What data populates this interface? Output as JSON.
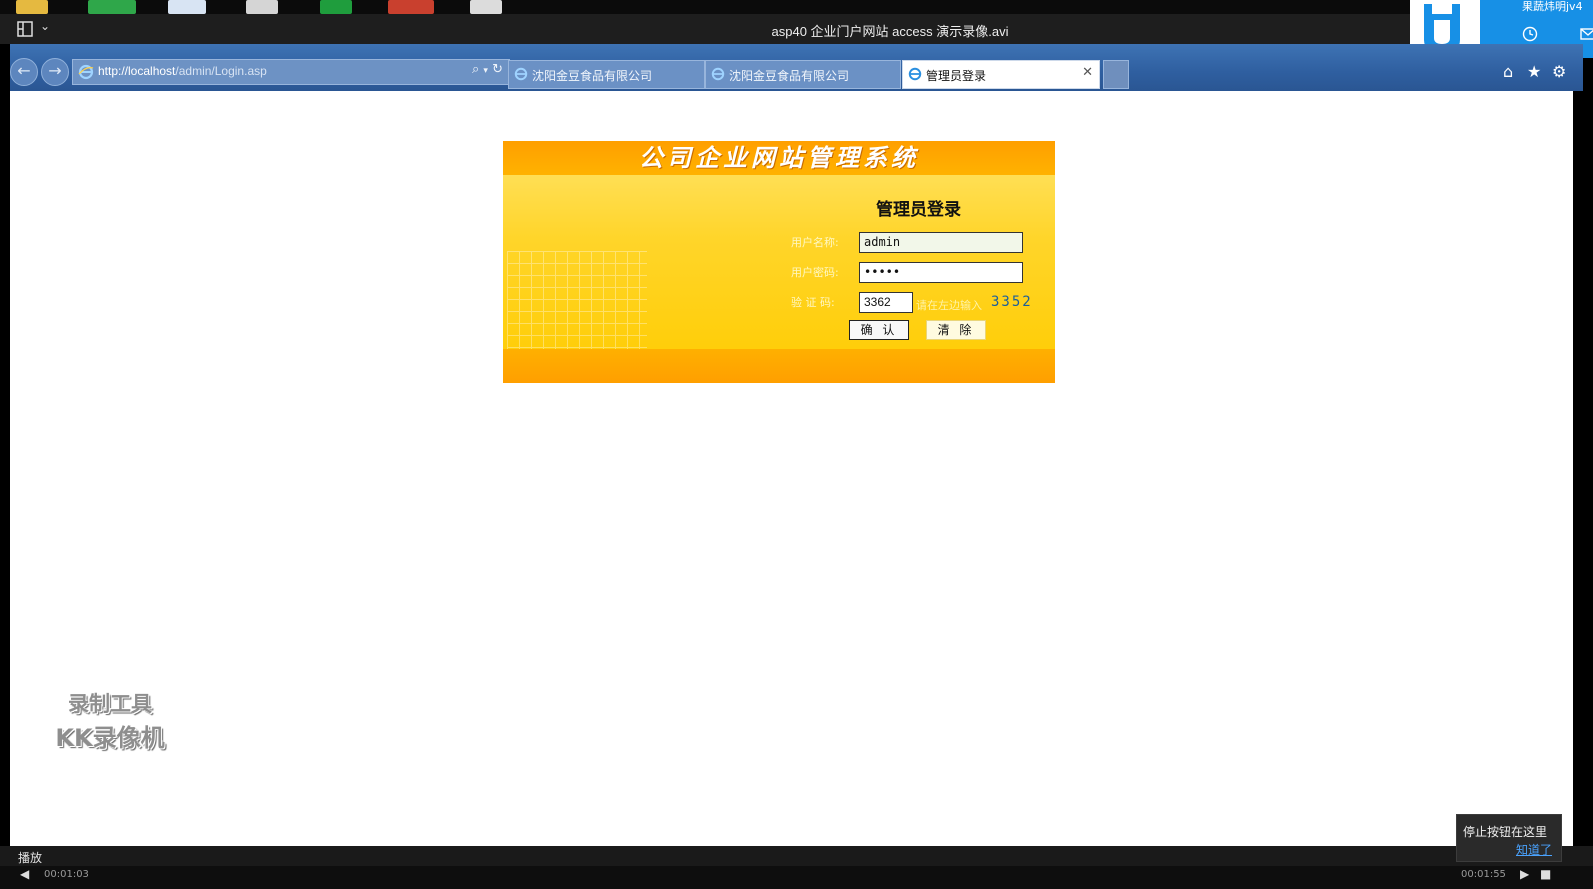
{
  "player": {
    "title": "asp40 企业门户网站 access 演示录像.avi",
    "status": "播放",
    "time_elapsed": "00:01:03",
    "time_total": "00:01:55",
    "tooltip_text": "停止按钮在这里",
    "tooltip_link": "知道了"
  },
  "notification": {
    "user_name": "果蔬炜明jv4"
  },
  "browser": {
    "address_host": "http://localhost",
    "address_path": "/admin/Login.asp",
    "tabs": [
      {
        "label": "沈阳金豆食品有限公司",
        "active": false
      },
      {
        "label": "沈阳金豆食品有限公司",
        "active": false
      },
      {
        "label": "管理员登录",
        "active": true
      }
    ]
  },
  "login": {
    "banner": "公司企业网站管理系统",
    "heading": "管理员登录",
    "username_label": "用户名称:",
    "username_value": "admin",
    "password_label": "用户密码:",
    "password_value": "•••••",
    "captcha_label": "验 证 码:",
    "captcha_value": "3362",
    "captcha_hint": "请在左边输入",
    "captcha_code": "3352",
    "confirm_label": "确 认",
    "clear_label": "清 除"
  },
  "watermark": {
    "line1": "录制工具",
    "line2": "KK录像机"
  },
  "colors": {
    "panel_orange": "#ff9f00",
    "panel_yellow": "#ffd52a",
    "notify_blue": "#1790e6",
    "link_blue": "#4aa3ff"
  },
  "icons": [
    "layout-icon",
    "chevron-down-icon",
    "back-icon",
    "forward-icon",
    "ie-icon",
    "search-icon",
    "refresh-icon",
    "close-icon",
    "home-icon",
    "star-icon",
    "gear-icon",
    "clock-icon",
    "mail-icon",
    "rewind-icon",
    "forward-skip-icon",
    "stop-icon"
  ]
}
